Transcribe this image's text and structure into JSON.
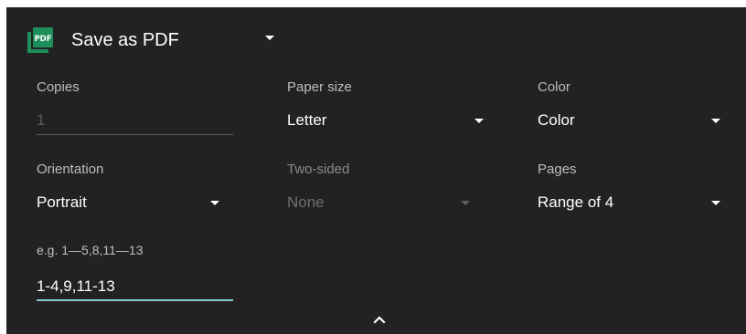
{
  "destination": {
    "label": "Save as PDF",
    "icon": "pdf-icon",
    "icon_text": "PDF",
    "icon_color": "#1e8e5a"
  },
  "copies": {
    "label": "Copies",
    "value": "1"
  },
  "paper_size": {
    "label": "Paper size",
    "value": "Letter"
  },
  "color": {
    "label": "Color",
    "value": "Color"
  },
  "orientation": {
    "label": "Orientation",
    "value": "Portrait"
  },
  "two_sided": {
    "label": "Two-sided",
    "value": "None"
  },
  "pages": {
    "label": "Pages",
    "value": "Range of 4"
  },
  "page_range": {
    "placeholder_hint": "e.g. 1—5,8,11—13",
    "value": "1-4,9,11-13"
  },
  "theme": {
    "background": "#222222",
    "accent": "#7ccccf"
  }
}
